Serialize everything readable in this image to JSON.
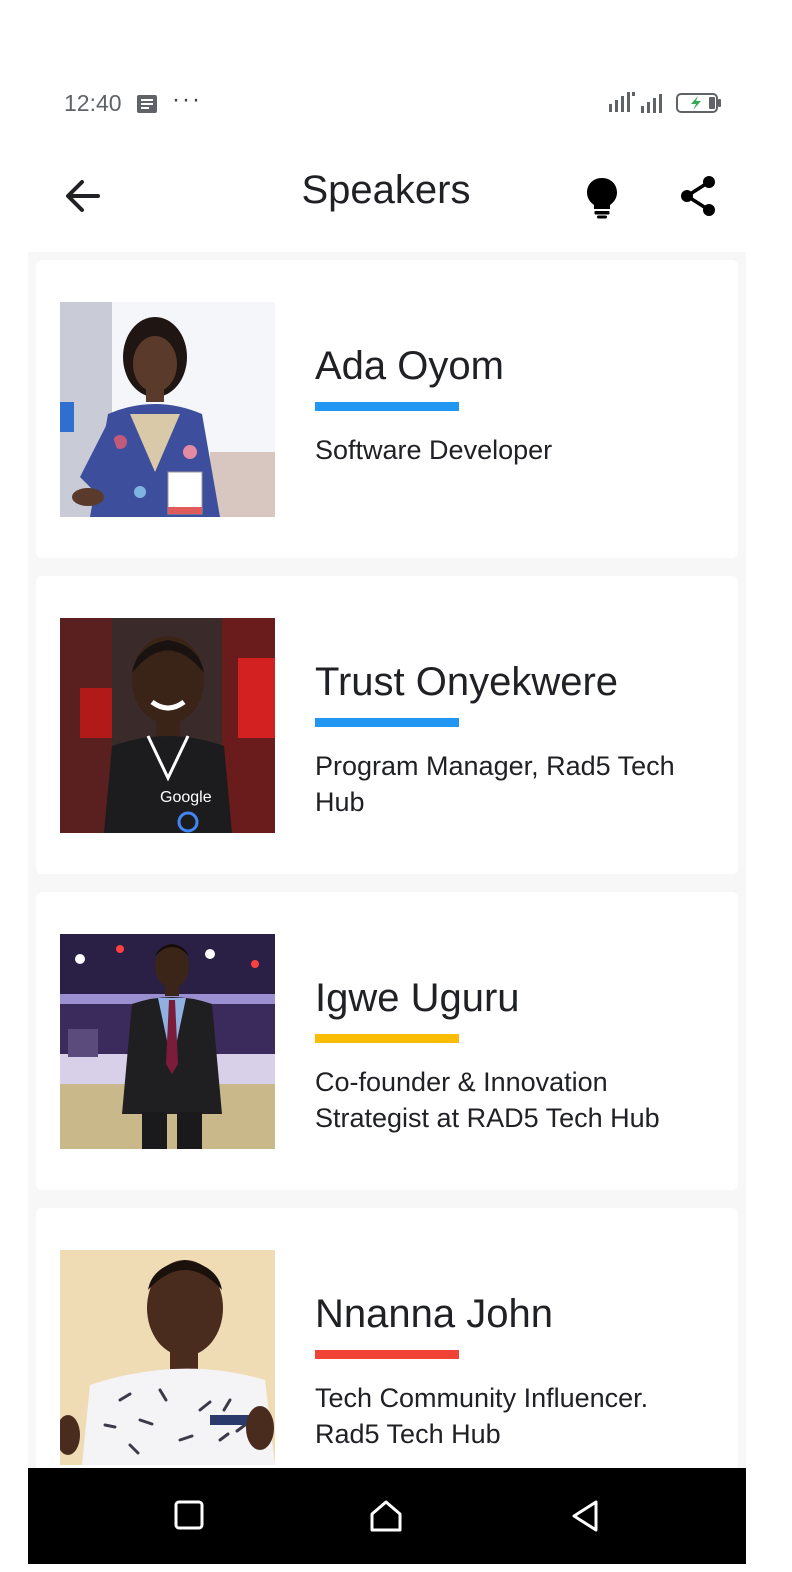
{
  "status_bar": {
    "time": "12:40",
    "more": "···",
    "icons": [
      "notification-icon",
      "signal-icon",
      "signal-icon",
      "battery-charging-icon"
    ]
  },
  "app_bar": {
    "title": "Speakers",
    "back_icon": "arrow-back-icon",
    "theme_icon": "lightbulb-icon",
    "share_icon": "share-icon"
  },
  "colors": {
    "accent_blue": "#2196f3",
    "accent_yellow": "#fbbc05",
    "accent_red": "#f14336",
    "list_background": "#f7f7f7",
    "nav_background": "#000000"
  },
  "speakers": [
    {
      "name": "Ada Oyom",
      "role": "Software Developer",
      "accent": "#2196f3"
    },
    {
      "name": "Trust Onyekwere",
      "role": "Program Manager, Rad5 Tech Hub",
      "accent": "#2196f3"
    },
    {
      "name": "Igwe Uguru",
      "role": "Co-founder & Innovation Strategist at RAD5 Tech Hub",
      "accent": "#fbbc05"
    },
    {
      "name": "Nnanna John",
      "role": "Tech Community Influencer. Rad5 Tech Hub",
      "accent": "#f14336"
    }
  ],
  "nav_bar": {
    "icons": [
      "recents-square-icon",
      "home-icon",
      "back-triangle-icon"
    ]
  }
}
